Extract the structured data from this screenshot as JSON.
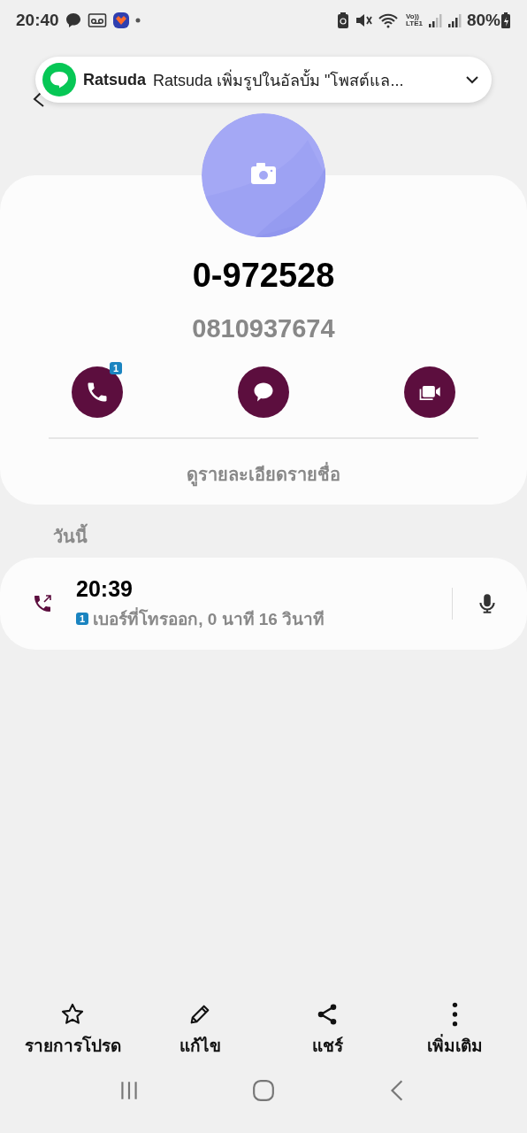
{
  "status_bar": {
    "time": "20:40",
    "network": [
      "Vo))",
      "LTE1"
    ],
    "battery": "80%"
  },
  "notification": {
    "sender": "Ratsuda",
    "message": "Ratsuda เพิ่มรูปในอัลบั้ม \"โพสต์แล..."
  },
  "contact": {
    "name": "0-972528",
    "number": "0810937674",
    "actions": [
      {
        "kind": "call",
        "badge": "1"
      },
      {
        "kind": "message"
      },
      {
        "kind": "video"
      }
    ],
    "details_link": "ดูรายละเอียดรายชื่อ"
  },
  "history": {
    "section": "วันนี้",
    "entries": [
      {
        "kind": "outgoing",
        "time": "20:39",
        "sim": "1",
        "description": "เบอร์ที่โทรออก, 0 นาที 16 วินาที"
      }
    ]
  },
  "bottom_actions": [
    {
      "kind": "favorite",
      "label": "รายการโปรด"
    },
    {
      "kind": "edit",
      "label": "แก้ไข"
    },
    {
      "kind": "share",
      "label": "แชร์"
    },
    {
      "kind": "more",
      "label": "เพิ่มเติม"
    }
  ]
}
